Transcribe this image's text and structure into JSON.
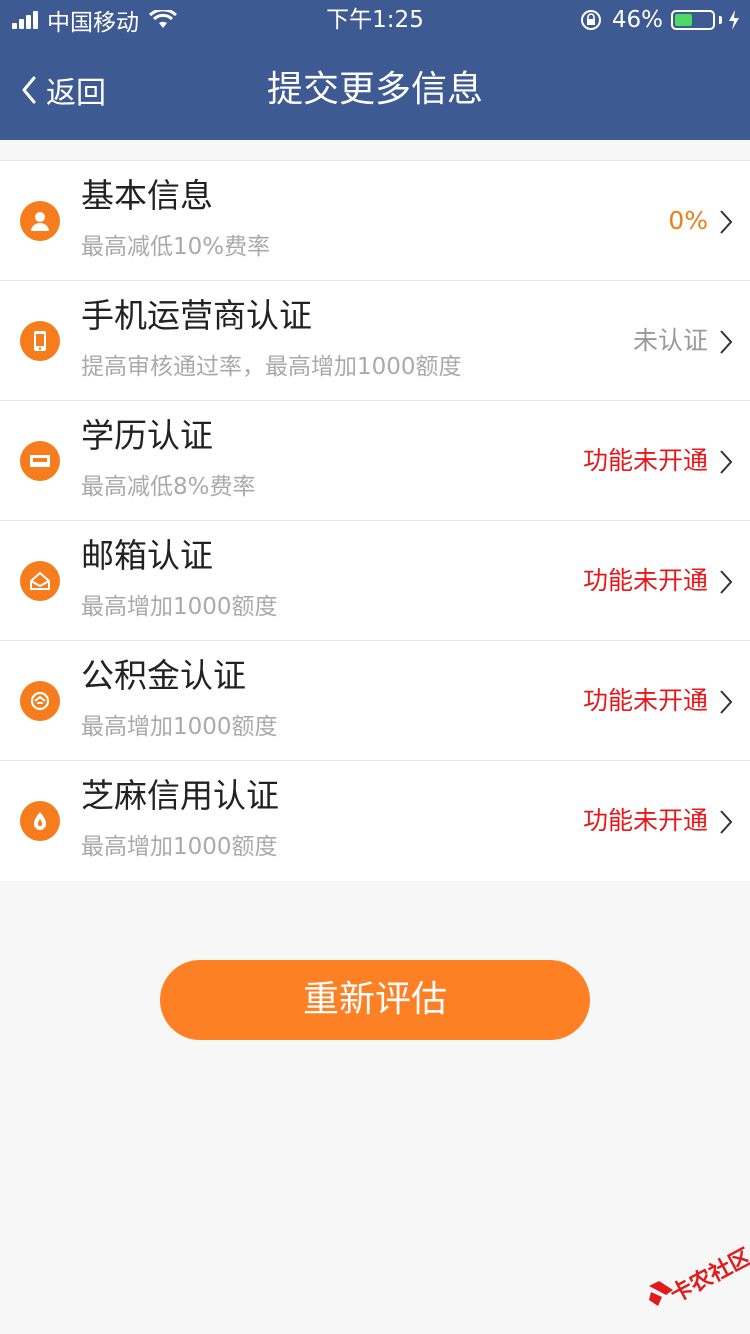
{
  "status_bar": {
    "carrier": "中国移动",
    "time": "下午1:25",
    "battery_percent_label": "46%",
    "battery_level": 0.46
  },
  "nav": {
    "back_label": "返回",
    "title": "提交更多信息"
  },
  "items": [
    {
      "title": "基本信息",
      "subtitle": "最高减低10%费率",
      "status": "0%",
      "icon": "person-icon"
    },
    {
      "title": "手机运营商认证",
      "subtitle": "提高审核通过率，最高增加1000额度",
      "status": "未认证",
      "icon": "phone-icon"
    },
    {
      "title": "学历认证",
      "subtitle": "最高减低8%费率",
      "status": "功能未开通",
      "icon": "diploma-icon"
    },
    {
      "title": "邮箱认证",
      "subtitle": "最高增加1000额度",
      "status": "功能未开通",
      "icon": "mail-icon"
    },
    {
      "title": "公积金认证",
      "subtitle": "最高增加1000额度",
      "status": "功能未开通",
      "icon": "fund-icon"
    },
    {
      "title": "芝麻信用认证",
      "subtitle": "最高增加1000额度",
      "status": "功能未开通",
      "icon": "sesame-icon"
    }
  ],
  "cta": {
    "label": "重新评估"
  },
  "watermark": {
    "text": "卡农社区"
  },
  "colors": {
    "header": "#3e5a93",
    "accent": "#f67d1e",
    "button": "#fd8024",
    "status_red": "#e5191b",
    "status_orange": "#ee7d18",
    "status_gray": "#999999"
  }
}
